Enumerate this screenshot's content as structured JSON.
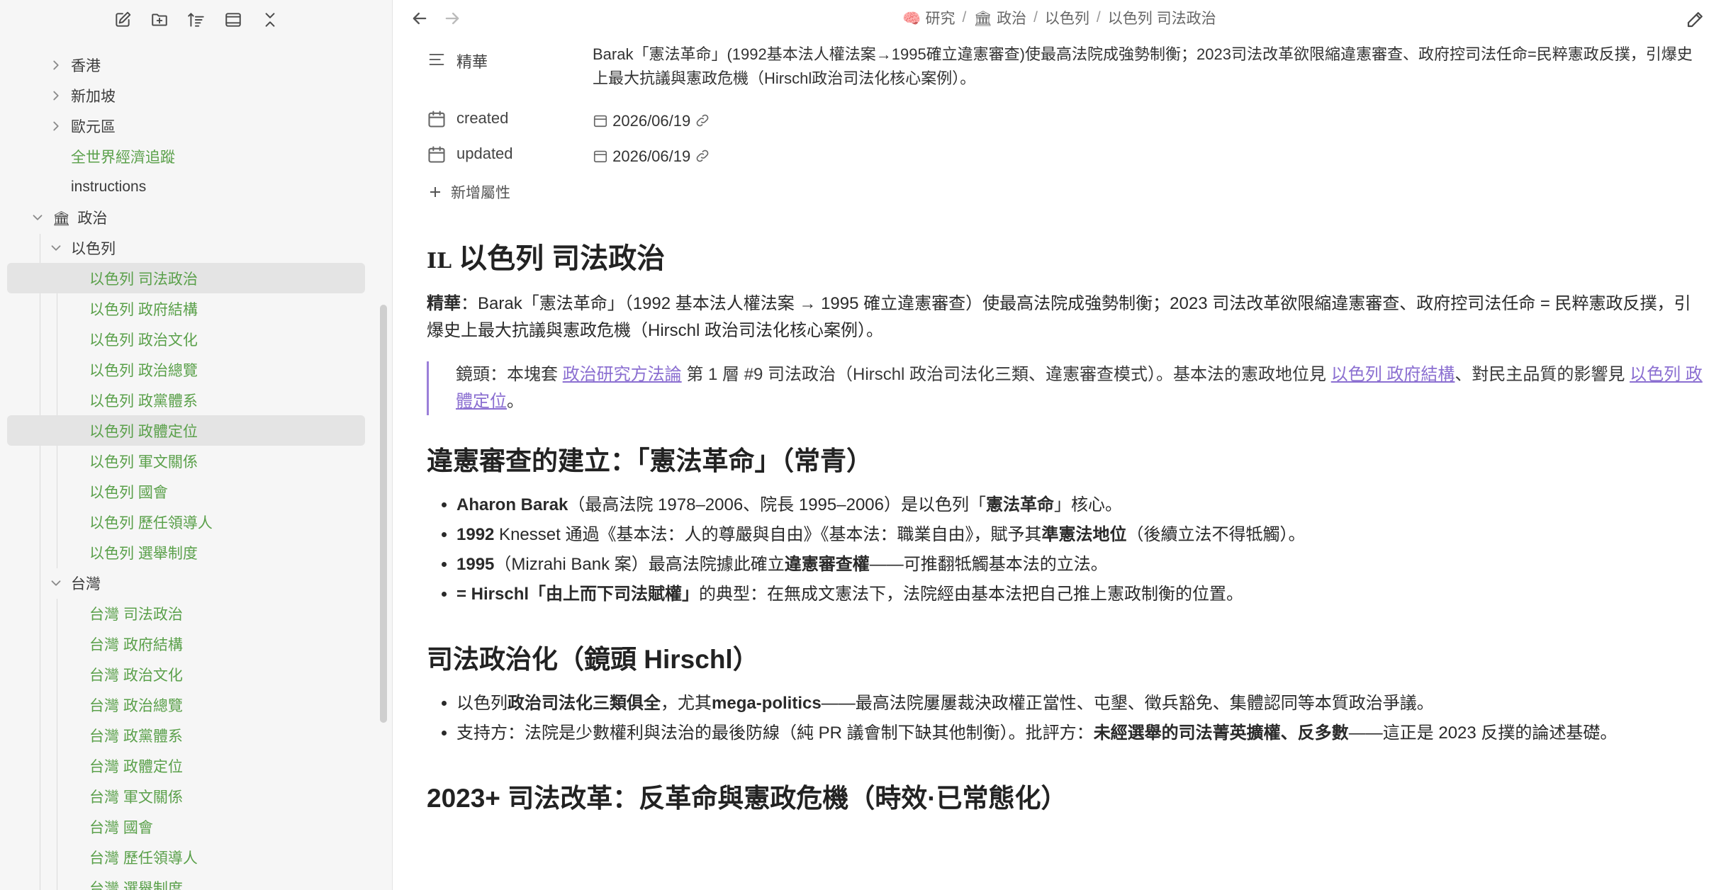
{
  "sidebar": {
    "toolbar": [
      "new-note-icon",
      "new-folder-icon",
      "sort-icon",
      "collapse-view-icon",
      "collapse-all-icon"
    ],
    "items": [
      {
        "label": "香港",
        "type": "folder",
        "depth": 1,
        "expanded": false
      },
      {
        "label": "新加坡",
        "type": "folder",
        "depth": 1,
        "expanded": false
      },
      {
        "label": "歐元區",
        "type": "folder",
        "depth": 1,
        "expanded": false
      },
      {
        "label": "全世界經濟追蹤",
        "type": "file",
        "depth": 1
      },
      {
        "label": "instructions",
        "type": "plain",
        "depth": 1
      },
      {
        "label": "政治",
        "type": "folder",
        "depth": 0,
        "expanded": true,
        "icon": "🏛"
      },
      {
        "label": "以色列",
        "type": "folder",
        "depth": 1,
        "expanded": true
      },
      {
        "label": "以色列 司法政治",
        "type": "file",
        "depth": 2,
        "selected": true
      },
      {
        "label": "以色列 政府結構",
        "type": "file",
        "depth": 2
      },
      {
        "label": "以色列 政治文化",
        "type": "file",
        "depth": 2
      },
      {
        "label": "以色列 政治總覽",
        "type": "file",
        "depth": 2
      },
      {
        "label": "以色列 政黨體系",
        "type": "file",
        "depth": 2
      },
      {
        "label": "以色列 政體定位",
        "type": "file",
        "depth": 2,
        "selected": true
      },
      {
        "label": "以色列 軍文關係",
        "type": "file",
        "depth": 2
      },
      {
        "label": "以色列 國會",
        "type": "file",
        "depth": 2
      },
      {
        "label": "以色列 歷任領導人",
        "type": "file",
        "depth": 2
      },
      {
        "label": "以色列 選舉制度",
        "type": "file",
        "depth": 2
      },
      {
        "label": "台灣",
        "type": "folder",
        "depth": 1,
        "expanded": true
      },
      {
        "label": "台灣 司法政治",
        "type": "file",
        "depth": 2
      },
      {
        "label": "台灣 政府結構",
        "type": "file",
        "depth": 2
      },
      {
        "label": "台灣 政治文化",
        "type": "file",
        "depth": 2
      },
      {
        "label": "台灣 政治總覽",
        "type": "file",
        "depth": 2
      },
      {
        "label": "台灣 政黨體系",
        "type": "file",
        "depth": 2
      },
      {
        "label": "台灣 政體定位",
        "type": "file",
        "depth": 2
      },
      {
        "label": "台灣 軍文關係",
        "type": "file",
        "depth": 2
      },
      {
        "label": "台灣 國會",
        "type": "file",
        "depth": 2
      },
      {
        "label": "台灣 歷任領導人",
        "type": "file",
        "depth": 2
      },
      {
        "label": "台灣 選舉制度",
        "type": "file",
        "depth": 2
      }
    ]
  },
  "breadcrumb": {
    "c1_emoji": "🧠",
    "c1": "研究",
    "c2_emoji": "🏛",
    "c2": "政治",
    "c3": "以色列",
    "c4": "以色列 司法政治",
    "sep": "/"
  },
  "properties": {
    "summary_name": "精華",
    "summary_value": "Barak「憲法革命」(1992基本法人權法案→1995確立違憲審查)使最高法院成強勢制衡；2023司法改革欲限縮違憲審查、政府控司法任命=民粹憲政反撲，引爆史上最大抗議與憲政危機（Hirschl政治司法化核心案例）。",
    "created_name": "created",
    "created_value": "2026/06/19",
    "updated_name": "updated",
    "updated_value": "2026/06/19",
    "add_label": "新增屬性"
  },
  "doc": {
    "flag": "IL",
    "title": "以色列 司法政治",
    "summary_label": "精華",
    "summary_text": "：Barak「憲法革命」（1992 基本法人權法案 → 1995 確立違憲審查）使最高法院成強勢制衡；2023 司法改革欲限縮違憲審查、政府控司法任命 = 民粹憲政反撲，引爆史上最大抗議與憲政危機（Hirschl 政治司法化核心案例）。",
    "quote": {
      "pre": "鏡頭：本塊套 ",
      "link1": "政治研究方法論",
      "mid": " 第 1 層 #9 司法政治（Hirschl 政治司法化三類、違憲審查模式）。基本法的憲政地位見 ",
      "link2": "以色列 政府結構",
      "mid2": "、對民主品質的影響見 ",
      "link3": "以色列 政體定位",
      "end": "。"
    },
    "h2_1": "違憲審查的建立：「憲法革命」（常青）",
    "list1": {
      "a_bold": "Aharon Barak",
      "a_text": "（最高法院 1978–2006、院長 1995–2006）是以色列「",
      "a_bold2": "憲法革命",
      "a_end": "」核心。",
      "b_bold": "1992",
      "b_text": " Knesset 通過《基本法：人的尊嚴與自由》《基本法：職業自由》，賦予其",
      "b_bold2": "準憲法地位",
      "b_end": "（後續立法不得牴觸）。",
      "c_bold": "1995",
      "c_text": "（Mizrahi Bank 案）最高法院據此確立",
      "c_bold2": "違憲審查權",
      "c_end": "——可推翻牴觸基本法的立法。",
      "d_bold": "= Hirschl「由上而下司法賦權」",
      "d_text": "的典型：在無成文憲法下，法院經由基本法把自己推上憲政制衡的位置。"
    },
    "h2_2": "司法政治化（鏡頭 Hirschl）",
    "list2": {
      "a_text": "以色列",
      "a_bold": "政治司法化三類俱全",
      "a_text2": "，尤其",
      "a_bold2": "mega-politics",
      "a_end": "——最高法院屢屢裁決政權正當性、屯墾、徵兵豁免、集體認同等本質政治爭議。",
      "b_text": "支持方：法院是少數權利與法治的最後防線（純 PR 議會制下缺其他制衡）。批評方：",
      "b_bold": "未經選舉的司法菁英擴權、反多數",
      "b_end": "——這正是 2023 反撲的論述基礎。"
    },
    "h2_3": "2023+ 司法改革：反革命與憲政危機（時效·已常態化）"
  }
}
